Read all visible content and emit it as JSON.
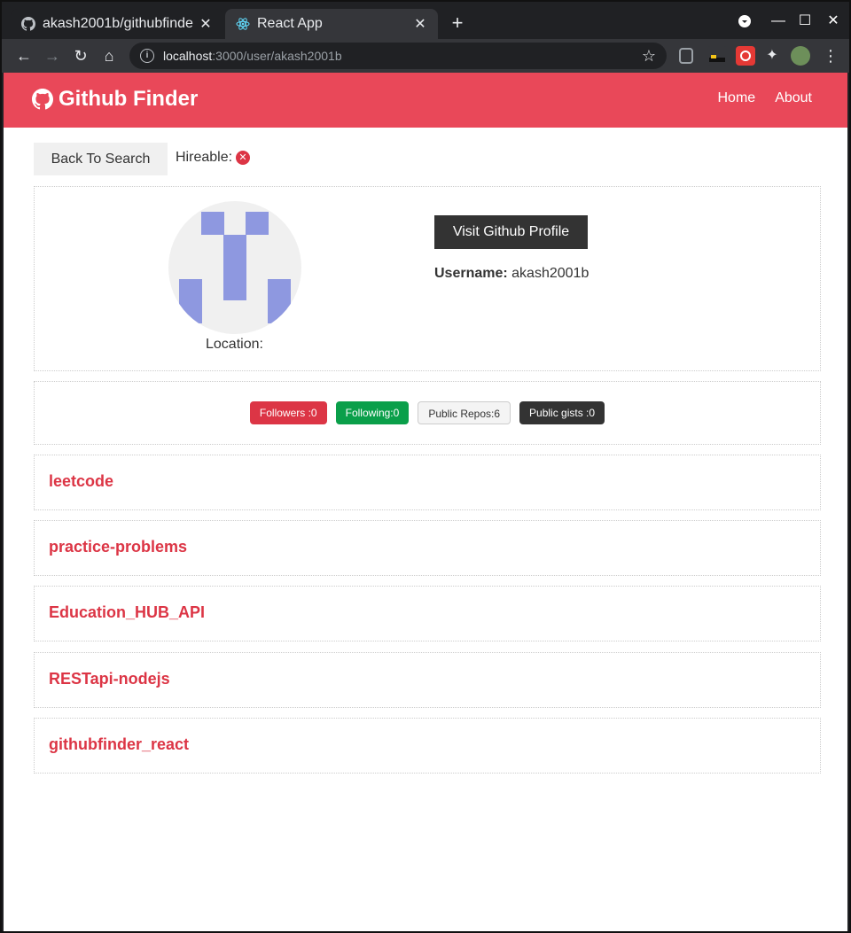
{
  "browser": {
    "tabs": [
      {
        "title": "akash2001b/githubfinde",
        "active": false
      },
      {
        "title": "React App",
        "active": true
      }
    ],
    "url_host": "localhost",
    "url_path": ":3000/user/akash2001b"
  },
  "navbar": {
    "brand": "Github Finder",
    "links": [
      "Home",
      "About"
    ],
    "color": "#e94859"
  },
  "actions": {
    "back_label": "Back To Search",
    "hireable_label": "Hireable:",
    "hireable_icon": "times-circle-icon"
  },
  "profile": {
    "location_label": "Location:",
    "visit_label": "Visit Github Profile",
    "username_label": "Username:",
    "username": "akash2001b"
  },
  "stats": {
    "followers": "Followers :0",
    "following": "Following:0",
    "repos": "Public Repos:6",
    "gists": "Public gists :0"
  },
  "repos": [
    "leetcode",
    "practice-problems",
    "Education_HUB_API",
    "RESTapi-nodejs",
    "githubfinder_react"
  ]
}
